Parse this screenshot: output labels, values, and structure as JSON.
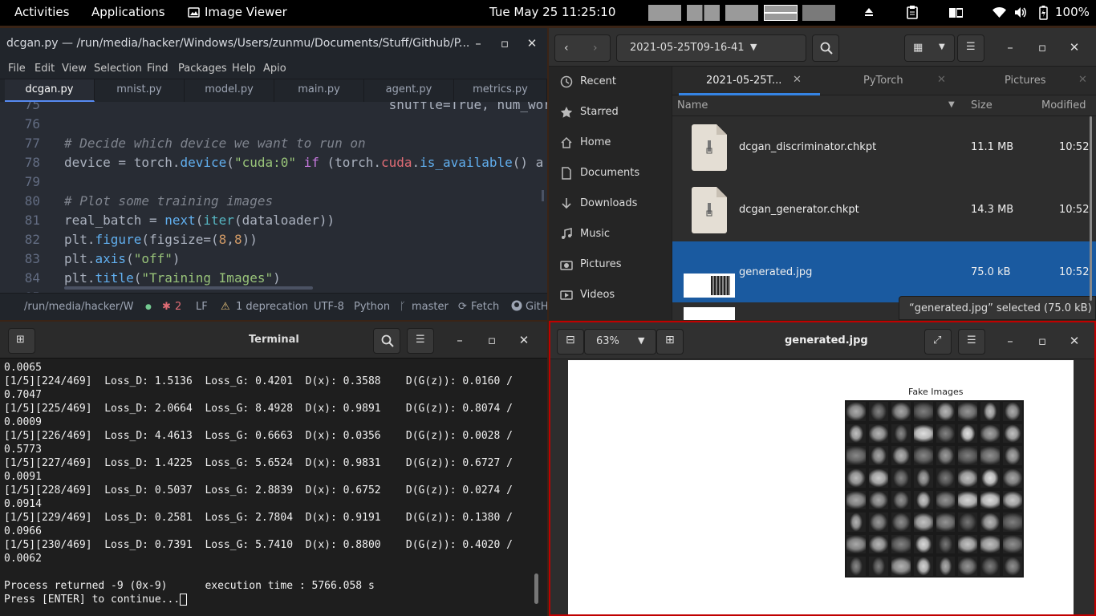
{
  "topbar": {
    "activities": "Activities",
    "applications": "Applications",
    "app_name": "Image Viewer",
    "datetime": "Tue May 25  11:25:10",
    "battery": "100%"
  },
  "atom": {
    "title": "dcgan.py — /run/media/hacker/Windows/Users/zunmu/Documents/Stuff/Github/P...",
    "menu": [
      "File",
      "Edit",
      "View",
      "Selection",
      "Find",
      "Packages",
      "Help",
      "Apio"
    ],
    "tabs": [
      "dcgan.py",
      "mnist.py",
      "model.py",
      "main.py",
      "agent.py",
      "metrics.py"
    ],
    "code_lines": [
      {
        "n": "75",
        "t": "                                          shuffle=True, num_wor"
      },
      {
        "n": "76",
        "t": ""
      },
      {
        "n": "77",
        "t": "# Decide which device we want to run on"
      },
      {
        "n": "78",
        "t": "device = torch.device(\"cuda:0\" if (torch.cuda.is_available() a"
      },
      {
        "n": "79",
        "t": ""
      },
      {
        "n": "80",
        "t": "# Plot some training images"
      },
      {
        "n": "81",
        "t": "real_batch = next(iter(dataloader))"
      },
      {
        "n": "82",
        "t": "plt.figure(figsize=(8,8))"
      },
      {
        "n": "83",
        "t": "plt.axis(\"off\")"
      },
      {
        "n": "84",
        "t": "plt.title(\"Training Images\")"
      },
      {
        "n": "85",
        "t": ""
      }
    ],
    "status": {
      "path": "/run/media/hacker/Wind",
      "bugs": "2",
      "line_ending": "LF",
      "deprecation": "1 deprecation",
      "encoding": "UTF-8",
      "grammar": "Python",
      "branch": "master",
      "fetch": "Fetch",
      "github": "GitH"
    }
  },
  "files": {
    "location": "2021-05-25T09-16-41",
    "sidebar": [
      "Recent",
      "Starred",
      "Home",
      "Documents",
      "Downloads",
      "Music",
      "Pictures",
      "Videos"
    ],
    "tabs": [
      "2021-05-25T...",
      "PyTorch",
      "Pictures"
    ],
    "columns": {
      "name": "Name",
      "size": "Size",
      "modified": "Modified"
    },
    "rows": [
      {
        "name": "dcgan_discriminator.chkpt",
        "size": "11.1 MB",
        "modified": "10:52"
      },
      {
        "name": "dcgan_generator.chkpt",
        "size": "14.3 MB",
        "modified": "10:52"
      },
      {
        "name": "generated.jpg",
        "size": "75.0 kB",
        "modified": "10:52"
      }
    ],
    "selection_status": "“generated.jpg” selected  (75.0 kB)",
    "accent": "#1a5aa0"
  },
  "terminal": {
    "title": "Terminal",
    "lines": [
      "0.0065",
      "[1/5][224/469]  Loss_D: 1.5136  Loss_G: 0.4201  D(x): 0.3588    D(G(z)): 0.0160 /",
      "0.7047",
      "[1/5][225/469]  Loss_D: 2.0664  Loss_G: 8.4928  D(x): 0.9891    D(G(z)): 0.8074 /",
      "0.0009",
      "[1/5][226/469]  Loss_D: 4.4613  Loss_G: 0.6663  D(x): 0.0356    D(G(z)): 0.0028 /",
      "0.5773",
      "[1/5][227/469]  Loss_D: 1.4225  Loss_G: 5.6524  D(x): 0.9831    D(G(z)): 0.6727 /",
      "0.0091",
      "[1/5][228/469]  Loss_D: 0.5037  Loss_G: 2.8839  D(x): 0.6752    D(G(z)): 0.0274 /",
      "0.0914",
      "[1/5][229/469]  Loss_D: 0.2581  Loss_G: 2.7804  D(x): 0.9191    D(G(z)): 0.1380 /",
      "0.0966",
      "[1/5][230/469]  Loss_D: 0.7391  Loss_G: 5.7410  D(x): 0.8800    D(G(z)): 0.4020 /",
      "0.0062",
      "",
      "Process returned -9 (0x-9)      execution time : 5766.058 s",
      "Press [ENTER] to continue..."
    ]
  },
  "viewer": {
    "zoom": "63%",
    "title": "generated.jpg",
    "image_title": "Fake Images"
  }
}
